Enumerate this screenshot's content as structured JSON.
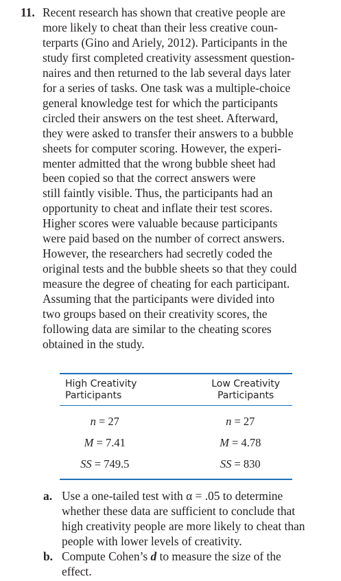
{
  "problem": {
    "number": "11.",
    "lines": [
      "Recent research has shown that creative people are",
      "more likely to cheat than their less creative coun-",
      "terparts (Gino and Ariely, 2012). Participants in the",
      "study first completed creativity assessment question-",
      "naires and then returned to the lab several days later",
      "for a series of tasks. One task was a multiple-choice",
      "general knowledge test for which the participants",
      "circled their answers on the test sheet. Afterward,",
      "they were asked to transfer their answers to a bubble",
      "sheets for computer scoring. However, the experi-",
      "menter admitted that the wrong bubble sheet had",
      "been copied so that the correct answers were",
      "still faintly visible. Thus, the participants had an",
      "opportunity to cheat and inflate their test scores.",
      "Higher scores were valuable because participants",
      "were paid based on the number of correct answers.",
      "However, the researchers had secretly coded the",
      "original tests and the bubble sheets so that they could",
      "measure the degree of cheating for each participant.",
      "Assuming that the participants were divided into",
      "two groups based on their creativity scores, the",
      "following data are similar to the cheating scores",
      "obtained in the study."
    ]
  },
  "table": {
    "headers": {
      "left": [
        "High Creativity",
        "Participants"
      ],
      "right": [
        "Low Creativity",
        "Participants"
      ]
    },
    "rows": [
      {
        "symbol": "n",
        "left": "= 27",
        "right": "= 27"
      },
      {
        "symbol": "M",
        "left": "= 7.41",
        "right": "= 4.78"
      },
      {
        "symbol": "SS",
        "left": "= 749.5",
        "right": "= 830"
      }
    ],
    "rule_color": "#1f6fb5"
  },
  "parts": {
    "a": {
      "label": "a.",
      "lines": [
        "Use a one-tailed test with α = .05 to determine",
        "whether these data are sufficient to conclude that",
        "high creativity people are more likely to cheat than",
        "people with lower levels of creativity."
      ]
    },
    "b": {
      "label": "b.",
      "line1_before": "Compute Cohen’s ",
      "line1_symbol": "d",
      "line1_after": " to measure the size of the",
      "line2": "effect."
    }
  }
}
